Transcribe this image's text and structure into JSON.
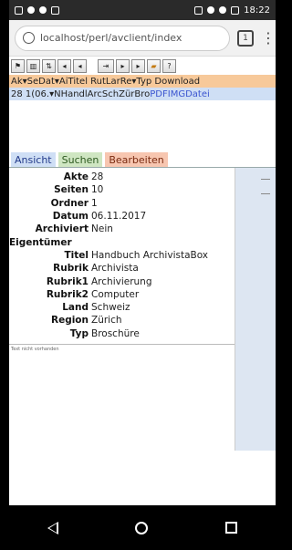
{
  "status_bar": {
    "time": "18:22"
  },
  "browser": {
    "url": "localhost/perl/avclient/index",
    "tab_count": "1"
  },
  "toolbar": {
    "buttons": [
      "flag-icon",
      "columns-icon",
      "sort-icon",
      "first-page-icon",
      "prev-page-icon",
      "goto-icon",
      "next-page-icon",
      "last-page-icon",
      "folder-icon",
      "help-icon"
    ],
    "help_label": "?"
  },
  "list": {
    "header": "Ak▾SeDat▾AiTitel  RutLarRe▾Typ Download",
    "row": {
      "text": "28 1(06.▾NHandlArcSchZürBro",
      "links": [
        "PDF",
        "IMG",
        "Datei"
      ]
    }
  },
  "tabs": {
    "ansicht": "Ansicht",
    "suchen": "Suchen",
    "bearbeiten": "Bearbeiten"
  },
  "detail": {
    "fields": [
      {
        "label": "Akte",
        "value": "28"
      },
      {
        "label": "Seiten",
        "value": "10"
      },
      {
        "label": "Ordner",
        "value": "1"
      },
      {
        "label": "Datum",
        "value": "06.11.2017"
      },
      {
        "label": "Archiviert",
        "value": "Nein"
      },
      {
        "label": "Eigentümer",
        "value": ""
      },
      {
        "label": "Titel",
        "value": "Handbuch ArchivistaBox"
      },
      {
        "label": "Rubrik",
        "value": "Archivista"
      },
      {
        "label": "Rubrik1",
        "value": "Archivierung"
      },
      {
        "label": "Rubrik2",
        "value": "Computer"
      },
      {
        "label": "Land",
        "value": "Schweiz"
      },
      {
        "label": "Region",
        "value": "Zürich"
      },
      {
        "label": "Typ",
        "value": "Broschüre"
      }
    ],
    "note": "Text nicht vorhanden"
  },
  "colors": {
    "header_bg": "#f7c99a",
    "row_bg": "#cfdff5",
    "link": "#3b55d0",
    "tab_ansicht": "#cfdff5",
    "tab_suchen": "#cfe6c2",
    "tab_bearbeiten": "#f7c6b0"
  }
}
